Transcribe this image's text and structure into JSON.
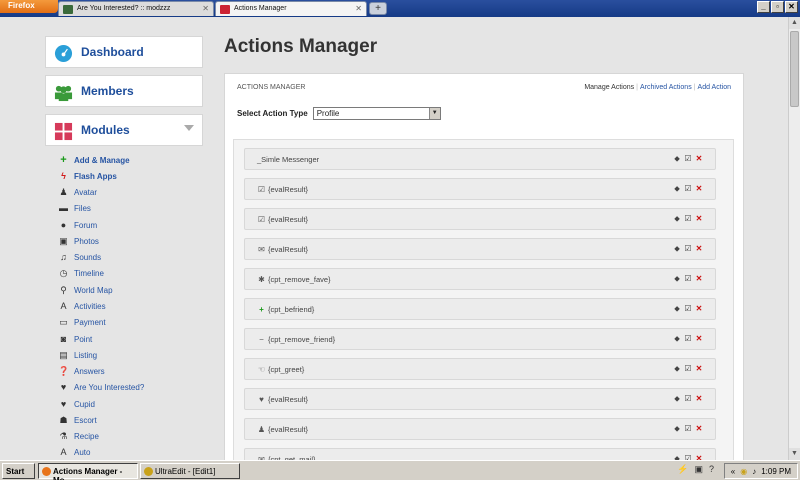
{
  "browser": {
    "app_button": "Firefox",
    "tabs": [
      {
        "label": "Are You Interested? :: modzzz"
      },
      {
        "label": "Actions Manager"
      }
    ],
    "new_tab": "+",
    "window_buttons": [
      "_",
      "▫",
      "✕"
    ]
  },
  "sidebar": {
    "dashboard": "Dashboard",
    "members": "Members",
    "modules": "Modules",
    "items": [
      {
        "label": "Add & Manage",
        "icon": "plus-icon"
      },
      {
        "label": "Flash Apps",
        "icon": "flash-icon"
      },
      {
        "label": "Avatar",
        "icon": "avatar-icon"
      },
      {
        "label": "Files",
        "icon": "files-icon"
      },
      {
        "label": "Forum",
        "icon": "forum-icon"
      },
      {
        "label": "Photos",
        "icon": "photos-icon"
      },
      {
        "label": "Sounds",
        "icon": "sounds-icon"
      },
      {
        "label": "Timeline",
        "icon": "timeline-icon"
      },
      {
        "label": "World Map",
        "icon": "map-pin-icon"
      },
      {
        "label": "Activities",
        "icon": "activities-icon"
      },
      {
        "label": "Payment",
        "icon": "payment-icon"
      },
      {
        "label": "Point",
        "icon": "point-icon"
      },
      {
        "label": "Listing",
        "icon": "listing-icon"
      },
      {
        "label": "Answers",
        "icon": "answers-icon"
      },
      {
        "label": "Are You Interested?",
        "icon": "heart-icon"
      },
      {
        "label": "Cupid",
        "icon": "heart-icon"
      },
      {
        "label": "Escort",
        "icon": "escort-icon"
      },
      {
        "label": "Recipe",
        "icon": "recipe-icon"
      },
      {
        "label": "Auto",
        "icon": "auto-icon"
      }
    ]
  },
  "main": {
    "title": "Actions Manager",
    "panel_header": "ACTIONS MANAGER",
    "links": {
      "manage": "Manage Actions",
      "archived": "Archived Actions",
      "add": "Add Action"
    },
    "select_label": "Select Action Type",
    "select_value": "Profile",
    "actions": [
      {
        "label": "_Simle Messenger",
        "icon": ""
      },
      {
        "label": "{evalResult}",
        "icon": "☑"
      },
      {
        "label": "{evalResult}",
        "icon": "☑"
      },
      {
        "label": "{evalResult}",
        "icon": "✉"
      },
      {
        "label": "{cpt_remove_fave}",
        "icon": "✱"
      },
      {
        "label": "{cpt_befriend}",
        "icon": "+"
      },
      {
        "label": "{cpt_remove_friend}",
        "icon": "−"
      },
      {
        "label": "{cpt_greet}",
        "icon": "☜"
      },
      {
        "label": "{evalResult}",
        "icon": "♥"
      },
      {
        "label": "{evalResult}",
        "icon": "♟"
      },
      {
        "label": "{cpt_get_mail}",
        "icon": "✉"
      }
    ]
  },
  "taskbar": {
    "start": "Start",
    "tasks": [
      {
        "label": "Actions Manager - Mo..."
      },
      {
        "label": "UltraEdit - [Edit1]"
      }
    ],
    "clock": "1:09 PM",
    "tray_prefix": "«"
  },
  "colors": {
    "link": "#2654a3",
    "delete": "#cc1010",
    "accent_blue": "#1e4e9b"
  }
}
